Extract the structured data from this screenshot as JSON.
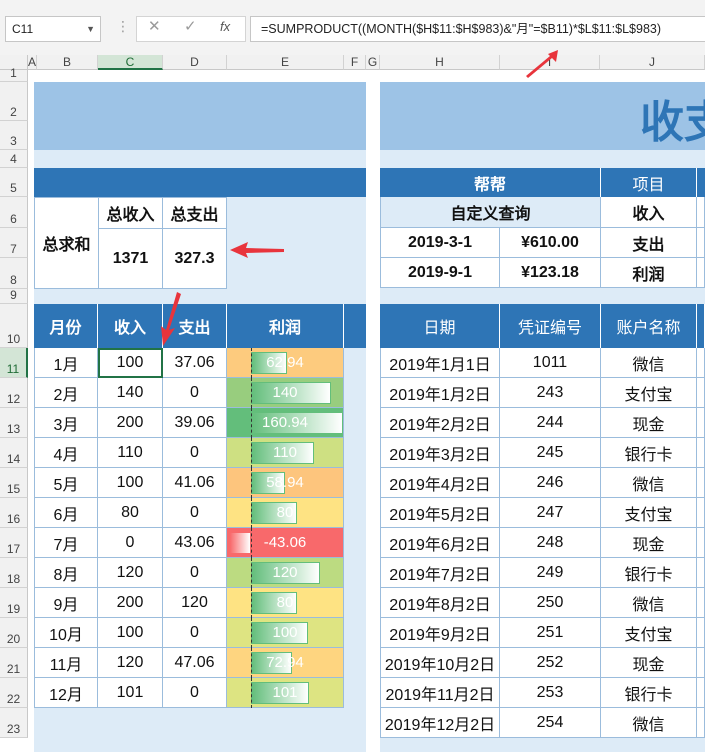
{
  "formula_bar": {
    "name_box": "C11",
    "formula": "=SUMPRODUCT((MONTH($H$11:$H$983)&\"月\"=$B11)*$L$11:$L$983)"
  },
  "columns": [
    "A",
    "B",
    "C",
    "D",
    "E",
    "F",
    "G",
    "H",
    "I",
    "J"
  ],
  "rows": [
    "1",
    "2",
    "3",
    "4",
    "5",
    "6",
    "7",
    "8",
    "9",
    "10",
    "11",
    "12",
    "13",
    "14",
    "15",
    "16",
    "17",
    "18",
    "19",
    "20",
    "21",
    "22",
    "23"
  ],
  "summary": {
    "label": "总求和",
    "income_header": "总收入",
    "expense_header": "总支出",
    "income_total": "1371",
    "expense_total": "327.3"
  },
  "monthly_table": {
    "headers": [
      "月份",
      "收入",
      "支出",
      "利润"
    ],
    "rows": [
      {
        "month": "1月",
        "income": "100",
        "expense": "37.06",
        "profit": "62.94",
        "pct": 0.39,
        "color": "#fdcb7e"
      },
      {
        "month": "2月",
        "income": "140",
        "expense": "0",
        "profit": "140",
        "pct": 0.87,
        "color": "#98cd7e"
      },
      {
        "month": "3月",
        "income": "200",
        "expense": "39.06",
        "profit": "160.94",
        "pct": 1.0,
        "color": "#63be7b"
      },
      {
        "month": "4月",
        "income": "110",
        "expense": "0",
        "profit": "110",
        "pct": 0.68,
        "color": "#cee082"
      },
      {
        "month": "5月",
        "income": "100",
        "expense": "41.06",
        "profit": "58.94",
        "pct": 0.37,
        "color": "#fdc57d"
      },
      {
        "month": "6月",
        "income": "80",
        "expense": "0",
        "profit": "80",
        "pct": 0.5,
        "color": "#fee383"
      },
      {
        "month": "7月",
        "income": "0",
        "expense": "43.06",
        "profit": "-43.06",
        "pct": 0.17,
        "color": "#f8696b"
      },
      {
        "month": "8月",
        "income": "120",
        "expense": "0",
        "profit": "120",
        "pct": 0.75,
        "color": "#bcdb81"
      },
      {
        "month": "9月",
        "income": "200",
        "expense": "120",
        "profit": "80",
        "pct": 0.5,
        "color": "#fee383"
      },
      {
        "month": "10月",
        "income": "100",
        "expense": "0",
        "profit": "100",
        "pct": 0.62,
        "color": "#dee482"
      },
      {
        "month": "11月",
        "income": "120",
        "expense": "47.06",
        "profit": "72.94",
        "pct": 0.45,
        "color": "#fed580"
      },
      {
        "month": "12月",
        "income": "101",
        "expense": "0",
        "profit": "101",
        "pct": 0.63,
        "color": "#dde482"
      }
    ]
  },
  "right_panel": {
    "title_partial": "收支",
    "header_label": "帮帮",
    "custom_query": "自定义查询",
    "project_header": "项目",
    "items": [
      "收入",
      "支出",
      "利润"
    ],
    "queries": [
      {
        "date": "2019-3-1",
        "amount": "¥610.00"
      },
      {
        "date": "2019-9-1",
        "amount": "¥123.18"
      }
    ],
    "ledger_headers": [
      "日期",
      "凭证编号",
      "账户名称"
    ],
    "ledger_rows": [
      {
        "date": "2019年1月1日",
        "voucher": "1011",
        "account": "微信"
      },
      {
        "date": "2019年1月2日",
        "voucher": "243",
        "account": "支付宝"
      },
      {
        "date": "2019年2月2日",
        "voucher": "244",
        "account": "现金"
      },
      {
        "date": "2019年3月2日",
        "voucher": "245",
        "account": "银行卡"
      },
      {
        "date": "2019年4月2日",
        "voucher": "246",
        "account": "微信"
      },
      {
        "date": "2019年5月2日",
        "voucher": "247",
        "account": "支付宝"
      },
      {
        "date": "2019年6月2日",
        "voucher": "248",
        "account": "现金"
      },
      {
        "date": "2019年7月2日",
        "voucher": "249",
        "account": "银行卡"
      },
      {
        "date": "2019年8月2日",
        "voucher": "250",
        "account": "微信"
      },
      {
        "date": "2019年9月2日",
        "voucher": "251",
        "account": "支付宝"
      },
      {
        "date": "2019年10月2日",
        "voucher": "252",
        "account": "现金"
      },
      {
        "date": "2019年11月2日",
        "voucher": "253",
        "account": "银行卡"
      },
      {
        "date": "2019年12月2日",
        "voucher": "254",
        "account": "微信"
      }
    ]
  },
  "colors": {
    "accent": "#2e75b6",
    "light": "#ddebf7",
    "title_band": "#9dc3e6",
    "excel_green": "#217346",
    "arrow": "#e8343c"
  }
}
